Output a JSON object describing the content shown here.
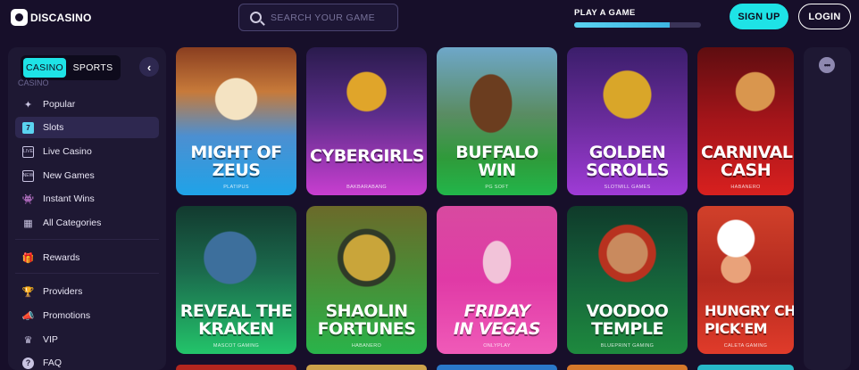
{
  "header": {
    "logo_text": "DISCASINO",
    "search_placeholder": "SEARCH YOUR GAME",
    "play_label": "PLAY A GAME",
    "progress": 0.75,
    "signup_label": "SIGN UP",
    "login_label": "LOGIN"
  },
  "sidebar": {
    "tabs": [
      "CASINO",
      "SPORTS"
    ],
    "active_tab": "CASINO",
    "section_label": "CASINO",
    "items": [
      {
        "label": "Popular",
        "icon": "sparkle-icon"
      },
      {
        "label": "Slots",
        "icon": "slot-machine-icon",
        "active": true
      },
      {
        "label": "Live Casino",
        "icon": "live-icon"
      },
      {
        "label": "New Games",
        "icon": "new-badge-icon"
      },
      {
        "label": "Instant Wins",
        "icon": "invader-icon"
      },
      {
        "label": "All Categories",
        "icon": "grid-icon"
      },
      {
        "label": "Rewards",
        "icon": "gift-icon"
      },
      {
        "label": "Providers",
        "icon": "trophy-icon"
      },
      {
        "label": "Promotions",
        "icon": "megaphone-icon"
      },
      {
        "label": "VIP",
        "icon": "crown-icon"
      },
      {
        "label": "FAQ",
        "icon": "question-icon"
      }
    ]
  },
  "games": [
    {
      "title": "MIGHT OF\nZEUS",
      "provider": "PLATIPUS"
    },
    {
      "title": "CYBERGIRLS",
      "provider": "BAKBARABANG"
    },
    {
      "title": "BUFFALO\nWIN",
      "provider": "PG SOFT"
    },
    {
      "title": "GOLDEN\nSCROLLS",
      "provider": "SLOTMILL GAMES"
    },
    {
      "title": "CARNIVAL\nCASH",
      "provider": "HABANERO"
    },
    {
      "title": "REVEAL THE\nKRAKEN",
      "provider": "MASCOT GAMING"
    },
    {
      "title": "SHAOLIN\nFORTUNES",
      "provider": "HABANERO"
    },
    {
      "title": "FRIDAY\nIN VEGAS",
      "provider": "ONLYPLAY"
    },
    {
      "title": "VOODOO\nTEMPLE",
      "provider": "BLUEPRINT GAMING"
    },
    {
      "title": "HUNGRY CHE\nPICK'EM",
      "provider": "CALETA GAMING"
    }
  ],
  "theme": {
    "accent": "#1ee3e6",
    "background": "#170f2a",
    "panel": "#1e1833"
  }
}
